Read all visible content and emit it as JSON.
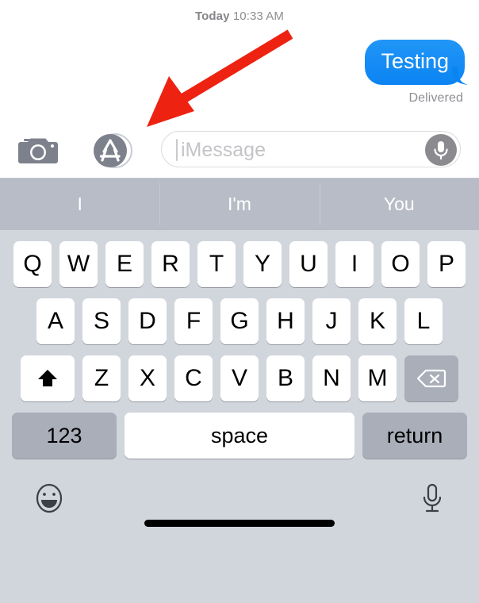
{
  "conversation": {
    "timestamp": {
      "day": "Today",
      "time": "10:33 AM"
    },
    "messages": [
      {
        "text": "Testing",
        "side": "outgoing",
        "status": "Delivered",
        "bubble_color": "#0b84f3"
      }
    ]
  },
  "input_bar": {
    "camera_icon": "camera-icon",
    "appstore_icon": "app-store-icon",
    "placeholder": "iMessage",
    "value": "",
    "mic_icon": "microphone-icon"
  },
  "keyboard": {
    "predictions": [
      "I",
      "I'm",
      "You"
    ],
    "rows": [
      [
        "Q",
        "W",
        "E",
        "R",
        "T",
        "Y",
        "U",
        "I",
        "O",
        "P"
      ],
      [
        "A",
        "S",
        "D",
        "F",
        "G",
        "H",
        "J",
        "K",
        "L"
      ],
      [
        "Z",
        "X",
        "C",
        "V",
        "B",
        "N",
        "M"
      ]
    ],
    "shift_key": "shift-icon",
    "delete_key": "delete-icon",
    "numeric_key": "123",
    "space_key": "space",
    "return_key": "return",
    "emoji_key": "emoji-icon",
    "dictation_key": "dictation-microphone-icon"
  },
  "annotation": {
    "arrow_color": "#ee2211",
    "points_to": "app-store-icon"
  }
}
